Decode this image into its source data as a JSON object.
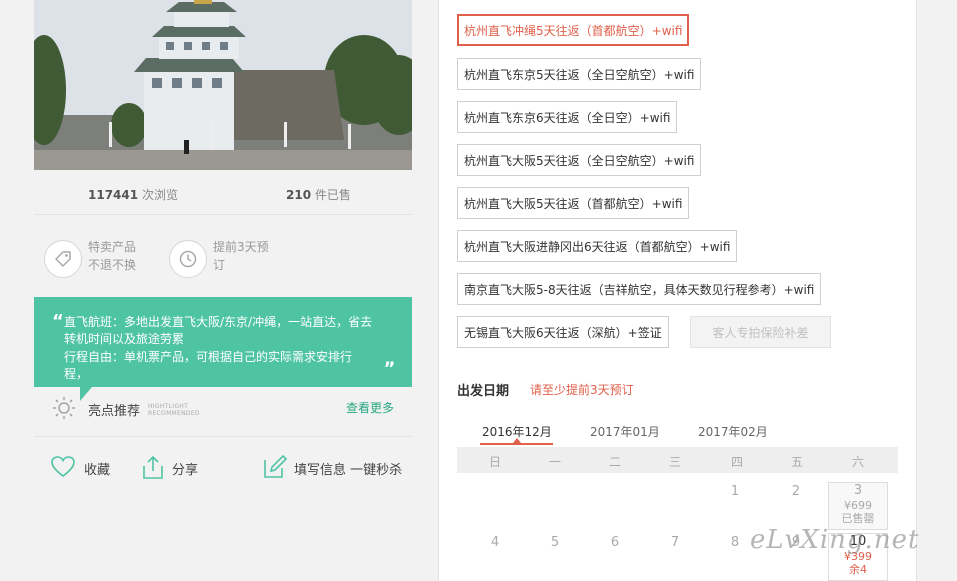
{
  "stats": {
    "views_count": "117441",
    "views_label": "次浏览",
    "sold_count": "210",
    "sold_label": "件已售"
  },
  "features": [
    {
      "line1": "特卖产品",
      "line2": "不退不换",
      "icon": "tag-icon"
    },
    {
      "line1": "提前3天预",
      "line2": "订",
      "icon": "clock-icon"
    }
  ],
  "highlight": {
    "line1": "直飞航班：多地出发直飞大阪/东京/冲绳，一站直达，省去",
    "line2": "转机时间以及旅途劳累",
    "line3": "行程自由：单机票产品，可根据自己的实际需求安排行程，",
    "title": "亮点推荐",
    "title_en_1": "HIGHTLIGHT",
    "title_en_2": "RECOMMENDED",
    "more_link": "查看更多",
    "quote_open": "“",
    "quote_close": "„"
  },
  "actions": {
    "favorite": "收藏",
    "share": "分享",
    "fill_info": "填写信息 一键秒杀"
  },
  "options": [
    {
      "label": "杭州直飞冲绳5天往返（首都航空）+wifi",
      "state": "selected"
    },
    {
      "label": "杭州直飞东京5天往返（全日空航空）+wifi",
      "state": "normal"
    },
    {
      "label": "杭州直飞东京6天往返（全日空）+wifi",
      "state": "normal"
    },
    {
      "label": "杭州直飞大阪5天往返（全日空航空）+wifi",
      "state": "normal"
    },
    {
      "label": "杭州直飞大阪5天往返（首都航空）+wifi",
      "state": "normal"
    },
    {
      "label": "杭州直飞大阪进静冈出6天往返（首都航空）+wifi",
      "state": "normal"
    },
    {
      "label": "南京直飞大阪5-8天往返（吉祥航空，具体天数见行程参考）+wifi",
      "state": "normal"
    },
    {
      "label": "无锡直飞大阪6天往返（深航）+签证",
      "state": "normal"
    },
    {
      "label": "客人专拍保险补差",
      "state": "disabled"
    }
  ],
  "departure": {
    "label": "出发日期",
    "note": "请至少提前3天预订",
    "months": [
      "2016年12月",
      "2017年01月",
      "2017年02月"
    ],
    "active_month": "2016年12月",
    "weekdays": [
      "日",
      "一",
      "二",
      "三",
      "四",
      "五",
      "六"
    ],
    "week1": [
      "1",
      "2"
    ],
    "week1_sat": {
      "day": "3",
      "price": "¥699",
      "status": "已售罄"
    },
    "week2": [
      "4",
      "5",
      "6",
      "7",
      "8",
      "9"
    ],
    "week2_sat": {
      "day": "10",
      "price": "¥399",
      "status": "余4"
    }
  },
  "watermark": "eLvXing.net",
  "colors": {
    "accent": "#e0604b",
    "green": "#4fc4a5",
    "link_green": "#2aa783"
  }
}
